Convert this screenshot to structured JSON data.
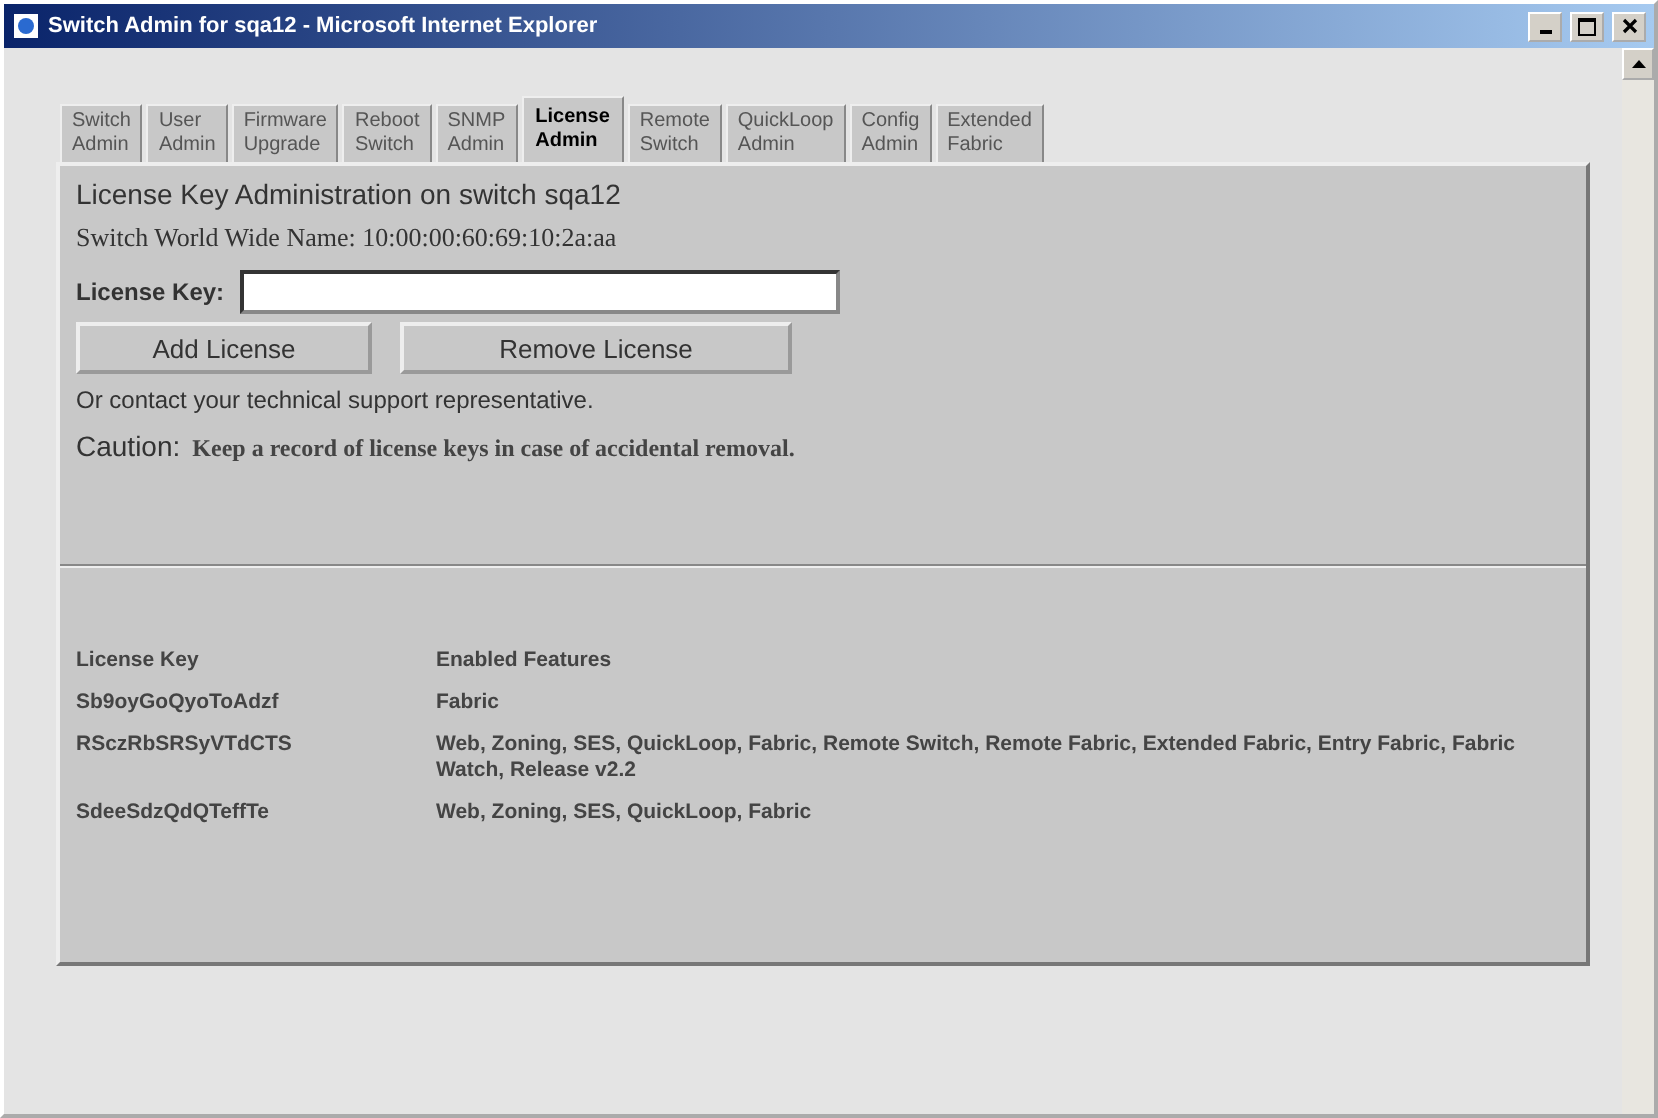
{
  "window": {
    "title": "Switch Admin for sqa12 - Microsoft Internet Explorer"
  },
  "tabs": [
    {
      "label": [
        "Switch",
        "Admin"
      ],
      "selected": false
    },
    {
      "label": [
        "User",
        "Admin"
      ],
      "selected": false
    },
    {
      "label": [
        "Firmware",
        "Upgrade"
      ],
      "selected": false
    },
    {
      "label": [
        "Reboot",
        "Switch"
      ],
      "selected": false
    },
    {
      "label": [
        "SNMP",
        "Admin"
      ],
      "selected": false
    },
    {
      "label": [
        "License",
        "Admin"
      ],
      "selected": true
    },
    {
      "label": [
        "Remote",
        "Switch"
      ],
      "selected": false
    },
    {
      "label": [
        "QuickLoop",
        "Admin"
      ],
      "selected": false
    },
    {
      "label": [
        "Config",
        "Admin"
      ],
      "selected": false
    },
    {
      "label": [
        "Extended",
        "Fabric"
      ],
      "selected": false
    }
  ],
  "heading": "License Key Administration on switch sqa12",
  "wwn": "Switch World Wide Name: 10:00:00:60:69:10:2a:aa",
  "license_key_label": "License Key:",
  "buttons": [
    "Add License",
    "Remove License"
  ],
  "contact": "Or contact your technical support representative.",
  "caution": {
    "label": "Caution:",
    "text": "Keep a record of license keys in case of accidental removal."
  },
  "table": {
    "columns": [
      "License Key",
      "Enabled Features"
    ],
    "rows": [
      [
        "Sb9oyGoQyoToAdzf",
        "Fabric"
      ],
      [
        "RSczRbSRSyVTdCTS",
        "Web, Zoning, SES, QuickLoop, Fabric, Remote Switch, Remote Fabric, Extended Fabric, Entry Fabric, Fabric Watch, Release v2.2"
      ],
      [
        "SdeeSdzQdQTeffTe",
        "Web, Zoning, SES, QuickLoop, Fabric"
      ]
    ]
  }
}
